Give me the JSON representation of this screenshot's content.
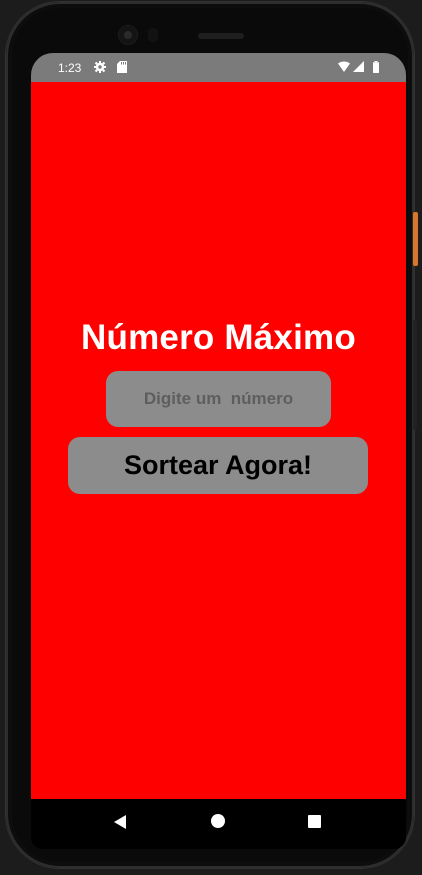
{
  "status_bar": {
    "time": "1:23",
    "icons": [
      "gear-icon",
      "sd-card-icon",
      "wifi-icon",
      "signal-icon",
      "battery-icon"
    ]
  },
  "app": {
    "background_color": "#ff0000",
    "title": "Número Máximo",
    "number_input": {
      "placeholder": "Digite um  número",
      "value": ""
    },
    "draw_button_label": "Sortear Agora!"
  },
  "navigation_bar": {
    "icons": [
      "back-icon",
      "home-icon",
      "recents-icon"
    ]
  },
  "colors": {
    "accent": "#ff0000",
    "control_bg": "#8c8c8c",
    "status_bar": "#7b7b7b",
    "title_text": "#ffffff",
    "button_text": "#000000"
  }
}
